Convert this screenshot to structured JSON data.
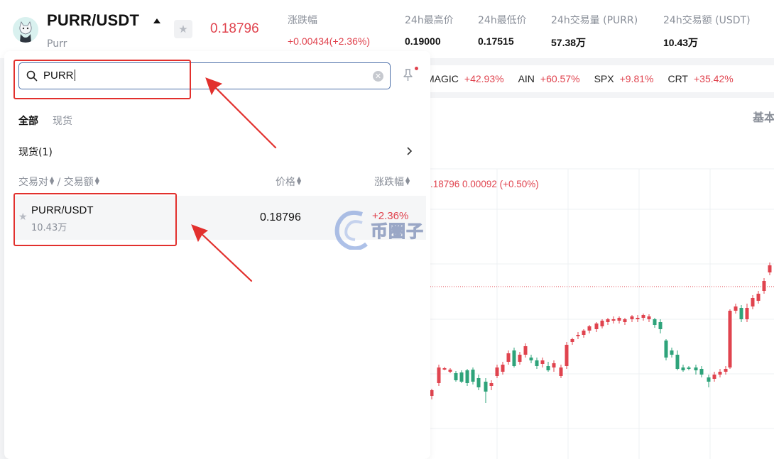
{
  "header": {
    "pair": "PURR/USDT",
    "subname": "Purr",
    "price": "0.18796",
    "stats": [
      {
        "label": "涨跌幅",
        "value": "+0.00434(+2.36%)"
      },
      {
        "label": "24h最高价",
        "value": "0.19000"
      },
      {
        "label": "24h最低价",
        "value": "0.17515"
      },
      {
        "label": "24h交易量 (PURR)",
        "value": "57.38万"
      },
      {
        "label": "24h交易额 (USDT)",
        "value": "10.43万"
      }
    ]
  },
  "ticker": [
    {
      "symbol": "MAGIC",
      "change": "+42.93%"
    },
    {
      "symbol": "AIN",
      "change": "+60.57%"
    },
    {
      "symbol": "SPX",
      "change": "+9.81%"
    },
    {
      "symbol": "CRT",
      "change": "+35.42%"
    }
  ],
  "chart": {
    "tab_label": "基本",
    "info": ".18796  0.00092 (+0.50%)"
  },
  "search": {
    "value": "PURR"
  },
  "tabs": {
    "all": "全部",
    "spot": "现货"
  },
  "section": {
    "title": "现货(1)"
  },
  "columns": {
    "pair": "交易对",
    "separator": "/",
    "volume": "交易额",
    "price": "价格",
    "change": "涨跌幅"
  },
  "results": [
    {
      "pair": "PURR/USDT",
      "volume": "10.43万",
      "price": "0.18796",
      "change": "+2.36%"
    }
  ],
  "watermark": {
    "text": "币圈子"
  },
  "colors": {
    "up": "#e0434e",
    "down": "#2ea37a",
    "annotation": "#e2302d"
  }
}
